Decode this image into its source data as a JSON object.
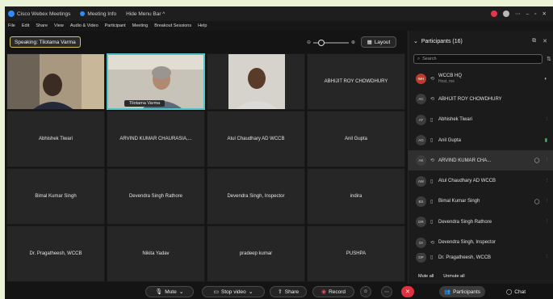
{
  "titlebar": {
    "app_title": "Cisco Webex Meetings",
    "meeting_info": "Meeting Info",
    "hide_menu": "Hide Menu Bar ^"
  },
  "menu": [
    "File",
    "Edit",
    "Share",
    "View",
    "Audio & Video",
    "Participant",
    "Meeting",
    "Breakout Sessions",
    "Help"
  ],
  "speaking_label": "Speaking: Tilotama Varma",
  "layout_label": "Layout",
  "tiles": [
    {
      "name": "",
      "has_video": true
    },
    {
      "name": "Tilotama Varma",
      "has_video": true,
      "active": true
    },
    {
      "name": "",
      "has_video": true
    },
    {
      "name": "ABHIJIT ROY CHOWDHURY"
    },
    {
      "name": "Abhishek Tiwari"
    },
    {
      "name": "ARVIND KUMAR CHAURASIA,..."
    },
    {
      "name": "Atul Chaudhary AD WCCB"
    },
    {
      "name": "Anil Gupta"
    },
    {
      "name": "Bimal Kumar Singh"
    },
    {
      "name": "Devendra Singh Rathore"
    },
    {
      "name": "Devendra Singh, Inspector"
    },
    {
      "name": "indira"
    },
    {
      "name": "Dr. Pragatheesh, WCCB"
    },
    {
      "name": "Nikita Yadav"
    },
    {
      "name": "pradeep kumar"
    },
    {
      "name": "PUSHPA"
    }
  ],
  "panel": {
    "title": "Participants (16)",
    "search_placeholder": "Search",
    "participants": [
      {
        "initials": "WH",
        "name": "WCCB HQ",
        "sub": "Host, me",
        "host": true,
        "device": "⟲",
        "mic": "none"
      },
      {
        "initials": "AC",
        "name": "ABHIJIT ROY CHOWDHURY",
        "sub": "",
        "device": "⟲",
        "mic": "none"
      },
      {
        "initials": "AT",
        "name": "Abhishek Tiwari",
        "sub": "",
        "device": "▯",
        "mic": "red"
      },
      {
        "initials": "AG",
        "name": "Anil Gupta",
        "sub": "",
        "device": "▯",
        "mic": "green"
      },
      {
        "initials": "AK",
        "name": "ARVIND KUMAR CHA...",
        "sub": "",
        "device": "⟲",
        "mic": "red",
        "selected": true
      },
      {
        "initials": "AW",
        "name": "Atul Chaudhary AD WCCB",
        "sub": "",
        "device": "▯",
        "mic": "red"
      },
      {
        "initials": "BS",
        "name": "Bimal Kumar Singh",
        "sub": "",
        "device": "▯",
        "mic": "red"
      },
      {
        "initials": "DR",
        "name": "Devendra Singh Rathore",
        "sub": "",
        "device": "▯",
        "mic": "red"
      },
      {
        "initials": "DI",
        "name": "Devendra Singh, Inspector",
        "sub": "",
        "device": "⟲",
        "mic": "none"
      },
      {
        "initials": "DP",
        "name": "Dr. Pragatheesh, WCCB",
        "sub": "",
        "device": "▯",
        "mic": "red"
      }
    ],
    "mute_all": "Mute all",
    "unmute_all": "Unmute all"
  },
  "controls": {
    "mute": "Mute",
    "stop_video": "Stop video",
    "share": "Share",
    "record": "Record",
    "participants": "Participants",
    "chat": "Chat"
  },
  "colors": {
    "accent_teal": "#4fc3c9",
    "end_red": "#e0323e",
    "muted_red": "#e74c5c",
    "unmuted_green": "#3cc46b"
  }
}
